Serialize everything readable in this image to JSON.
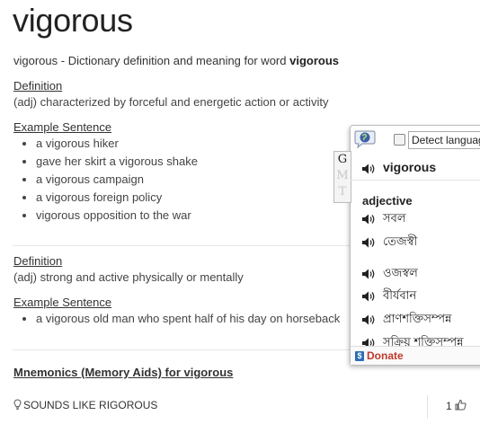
{
  "page": {
    "title": "vigorous",
    "subtitle_prefix": "vigorous - Dictionary definition and meaning for word ",
    "subtitle_word": "vigorous"
  },
  "definitions": [
    {
      "label": "Definition",
      "text": "(adj) characterized by forceful and energetic action or activity",
      "example_label": "Example Sentence",
      "examples": [
        "a vigorous hiker",
        "gave her skirt a vigorous shake",
        "a vigorous campaign",
        "a vigorous foreign policy",
        "vigorous opposition to the war"
      ]
    },
    {
      "label": "Definition",
      "text": "(adj) strong and active physically or mentally",
      "example_label": "Example Sentence",
      "examples": [
        "a vigorous old man who spent half of his day on horseback"
      ]
    }
  ],
  "mnemonics": {
    "heading": "Mnemonics (Memory Aids) for vigorous",
    "item_text": "SOUNDS LIKE RIGOROUS",
    "like_count": "1"
  },
  "popup": {
    "detect_label": "Detect language",
    "tabs": [
      "G",
      "M",
      "T"
    ],
    "word": "vigorous",
    "part_of_speech": "adjective",
    "translations": [
      "সবল",
      "তেজস্বী",
      "ওজস্বল",
      "বীর্যবান",
      "প্রাণশক্তিসম্পন্ন",
      "সক্রিয় শক্তিসম্পন্ন"
    ],
    "donate_label": "Donate",
    "accent_color": "#c0392b"
  }
}
